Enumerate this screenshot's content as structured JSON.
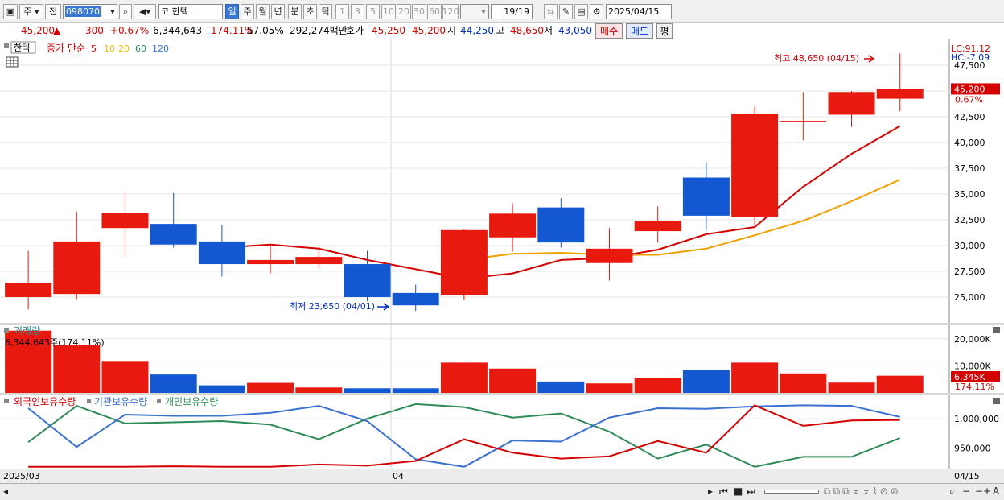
{
  "toolbar": {
    "market_label": "주",
    "prev_label": "전",
    "code_value": "098070",
    "name_prefix": "코",
    "name_value": "한텍",
    "periods": [
      "일",
      "주",
      "월",
      "년",
      "분",
      "초",
      "틱"
    ],
    "selected_period": "일",
    "intervals": [
      "1",
      "3",
      "5",
      "10",
      "20",
      "30",
      "60",
      "120"
    ],
    "count": "19/19",
    "date": "2025/04/15"
  },
  "quote": {
    "price": "45,200",
    "change": "300",
    "change_pct": "+0.67%",
    "volume": "6,344,643",
    "volume_ratio": "174.11%",
    "pct2": "57.05%",
    "amount": "292,274백만",
    "ask_label": "호가",
    "ask": "45,250",
    "bid": "45,200",
    "open_label": "시",
    "open": "44,250",
    "high_label": "고",
    "high": "48,650",
    "low_label": "저",
    "low": "43,050",
    "buy_label": "매수",
    "sell_label": "매도",
    "eval_label": "평"
  },
  "price_panel": {
    "stock_name": "한텍",
    "indicator_label": "종가 단순",
    "ma_periods": [
      "5",
      "10",
      "20",
      "60",
      "120"
    ],
    "ma_colors": [
      "#d40000",
      "#f0c000",
      "#f0c000",
      "#2e8b57",
      "#3a70d0"
    ],
    "lc_label": "LC:91.12",
    "hc_label": "HC:-7.09",
    "current_price_tag": "45,200",
    "current_pct_tag": "0.67%",
    "high_annotation": "최고 48,650 (04/15)",
    "low_annotation": "최저 23,650 (04/01)"
  },
  "volume_panel": {
    "title": "거래량",
    "value_label": "6,344,643주(174.11%)",
    "current_tag": "6,345K",
    "current_pct": "174.11%"
  },
  "holding_panel": {
    "series_labels": [
      "외국인보유수량",
      "기관보유수량",
      "개인보유수량"
    ],
    "series_colors": [
      "#d40000",
      "#3a70d0",
      "#2e8b57"
    ]
  },
  "x_axis": {
    "start_label": "2025/03",
    "mid_label": "04",
    "end_label": "04/15"
  },
  "chart_data": [
    {
      "type": "candlestick",
      "ylim": [
        22500,
        50000
      ],
      "yticks": [
        25000,
        27500,
        30000,
        32500,
        35000,
        37500,
        40000,
        42500,
        47500
      ],
      "ytick_labels": [
        "25,000",
        "27,500",
        "30,000",
        "32,500",
        "35,000",
        "37,500",
        "40,000",
        "42,500",
        "47,500"
      ],
      "candles": [
        {
          "open": 25000,
          "high": 29500,
          "low": 23800,
          "close": 26400
        },
        {
          "open": 25300,
          "high": 33300,
          "low": 24800,
          "close": 30400
        },
        {
          "open": 31700,
          "high": 35100,
          "low": 28900,
          "close": 33200
        },
        {
          "open": 32100,
          "high": 35100,
          "low": 29800,
          "close": 30100
        },
        {
          "open": 30400,
          "high": 32000,
          "low": 27000,
          "close": 28200
        },
        {
          "open": 28200,
          "high": 30000,
          "low": 27300,
          "close": 28600
        },
        {
          "open": 28200,
          "high": 30000,
          "low": 27800,
          "close": 28900
        },
        {
          "open": 28200,
          "high": 29500,
          "low": 24600,
          "close": 25000
        },
        {
          "open": 25400,
          "high": 26200,
          "low": 23650,
          "close": 24200
        },
        {
          "open": 25200,
          "high": 31600,
          "low": 24700,
          "close": 31500
        },
        {
          "open": 30800,
          "high": 34100,
          "low": 29400,
          "close": 33100
        },
        {
          "open": 33700,
          "high": 34600,
          "low": 29800,
          "close": 30300
        },
        {
          "open": 28300,
          "high": 31700,
          "low": 26600,
          "close": 29700
        },
        {
          "open": 31400,
          "high": 33800,
          "low": 30300,
          "close": 32400
        },
        {
          "open": 36600,
          "high": 38100,
          "low": 31500,
          "close": 32900
        },
        {
          "open": 32800,
          "high": 43500,
          "low": 32000,
          "close": 42800
        },
        {
          "open": 42100,
          "high": 44900,
          "low": 40200,
          "close": 42100
        },
        {
          "open": 42700,
          "high": 45000,
          "low": 41500,
          "close": 44900
        },
        {
          "open": 44250,
          "high": 48650,
          "low": 43050,
          "close": 45200
        }
      ],
      "ma5": [
        null,
        null,
        null,
        null,
        29800,
        30100,
        29700,
        28600,
        27700,
        26800,
        27300,
        28600,
        28800,
        29600,
        31100,
        31800,
        35700,
        38900,
        41600
      ],
      "ma10": [
        null,
        null,
        null,
        null,
        null,
        null,
        null,
        null,
        null,
        28600,
        29200,
        29300,
        29100,
        29100,
        29700,
        31000,
        32400,
        34300,
        36400
      ]
    },
    {
      "type": "bar",
      "ylim": [
        0,
        25000
      ],
      "yticks": [
        10000,
        20000
      ],
      "ytick_labels": [
        "10,000K",
        "20,000K"
      ],
      "values": [
        23000,
        17700,
        11800,
        6800,
        2800,
        3700,
        2000,
        1700,
        1700,
        11200,
        9000,
        4200,
        3500,
        5500,
        8400,
        11200,
        7200,
        3800,
        6345
      ]
    },
    {
      "type": "line",
      "ylim": [
        915000,
        1040000
      ],
      "yticks": [
        950000,
        1000000
      ],
      "ytick_labels": [
        "950,000",
        "1,000,000"
      ],
      "series": [
        {
          "name": "외국인보유수량",
          "values": [
            918000,
            918000,
            918000,
            919000,
            918000,
            918000,
            922000,
            920000,
            928000,
            965000,
            942000,
            932000,
            936000,
            962000,
            942000,
            1023000,
            988000,
            997000,
            998000
          ]
        },
        {
          "name": "기관보유수량",
          "values": [
            1018000,
            952000,
            1007000,
            1005000,
            1005000,
            1010000,
            1022000,
            996000,
            931000,
            918000,
            963000,
            961000,
            1002000,
            1018000,
            1017000,
            1021000,
            1023000,
            1022000,
            1003000
          ]
        },
        {
          "name": "개인보유수량",
          "values": [
            960000,
            1022000,
            992000,
            994000,
            996000,
            990000,
            965000,
            1000000,
            1025000,
            1020000,
            1002000,
            1009000,
            978000,
            932000,
            956000,
            918000,
            935000,
            935000,
            967000
          ]
        }
      ]
    }
  ]
}
